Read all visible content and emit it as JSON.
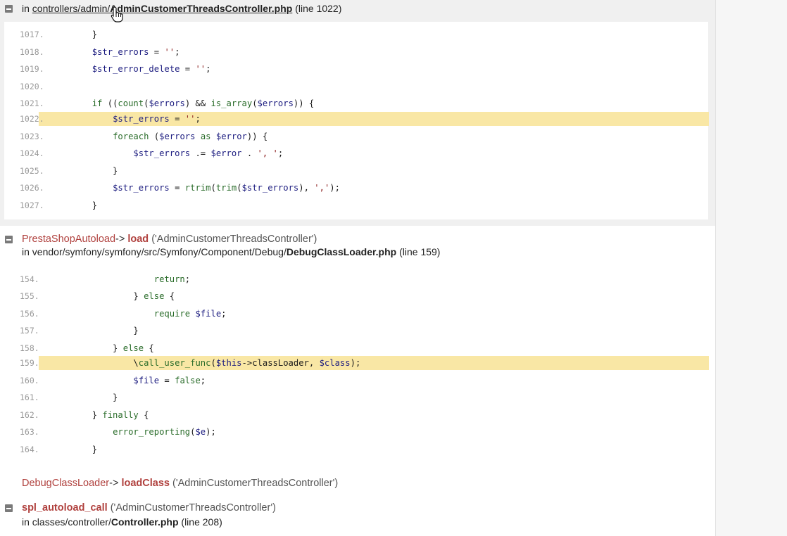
{
  "frames": {
    "frame1": {
      "in": "in",
      "path_dir": "controllers/admin/",
      "file": "AdminCustomerThreadsController.php",
      "line": "(line 1022)",
      "code": [
        {
          "n": "1017.",
          "t": "        }"
        },
        {
          "n": "1018.",
          "t": "        $str_errors = '';"
        },
        {
          "n": "1019.",
          "t": "        $str_error_delete = '';"
        },
        {
          "n": "1020.",
          "t": ""
        },
        {
          "n": "1021.",
          "t": "        if ((count($errors) && is_array($errors)) {"
        },
        {
          "n": "1022.",
          "t": "            $str_errors = '';"
        },
        {
          "n": "1023.",
          "t": "            foreach ($errors as $error)) {"
        },
        {
          "n": "1024.",
          "t": "                $str_errors .= $error . ', ';"
        },
        {
          "n": "1025.",
          "t": "            }"
        },
        {
          "n": "1026.",
          "t": "            $str_errors = rtrim(trim($str_errors), ',');"
        },
        {
          "n": "1027.",
          "t": "        }"
        }
      ]
    },
    "frame2": {
      "class": "PrestaShopAutoload",
      "arrow": "->",
      "method": "load",
      "args": "('AdminCustomerThreadsController')",
      "in": "in",
      "path_dir": "vendor/symfony/symfony/src/Symfony/Component/Debug/",
      "file": "DebugClassLoader.php",
      "line": "(line 159)",
      "code": [
        {
          "n": "154.",
          "t": "                    return;"
        },
        {
          "n": "155.",
          "t": "                } else {"
        },
        {
          "n": "156.",
          "t": "                    require $file;"
        },
        {
          "n": "157.",
          "t": "                }"
        },
        {
          "n": "158.",
          "t": "            } else {"
        },
        {
          "n": "159.",
          "t": "                \\call_user_func($this->classLoader, $class);"
        },
        {
          "n": "160.",
          "t": "                $file = false;"
        },
        {
          "n": "161.",
          "t": "            }"
        },
        {
          "n": "162.",
          "t": "        } finally {"
        },
        {
          "n": "163.",
          "t": "            error_reporting($e);"
        },
        {
          "n": "164.",
          "t": "        }"
        }
      ]
    },
    "frame3": {
      "class": "DebugClassLoader",
      "arrow": "->",
      "method": "loadClass",
      "args": "('AdminCustomerThreadsController')"
    },
    "frame4": {
      "method": "spl_autoload_call",
      "args": "('AdminCustomerThreadsController')",
      "in": "in",
      "path_dir": "classes/controller/",
      "file": "Controller.php",
      "line": "(line 208)"
    }
  },
  "highlight_color": "#f9e7a5",
  "accent_color": "#b0413e"
}
